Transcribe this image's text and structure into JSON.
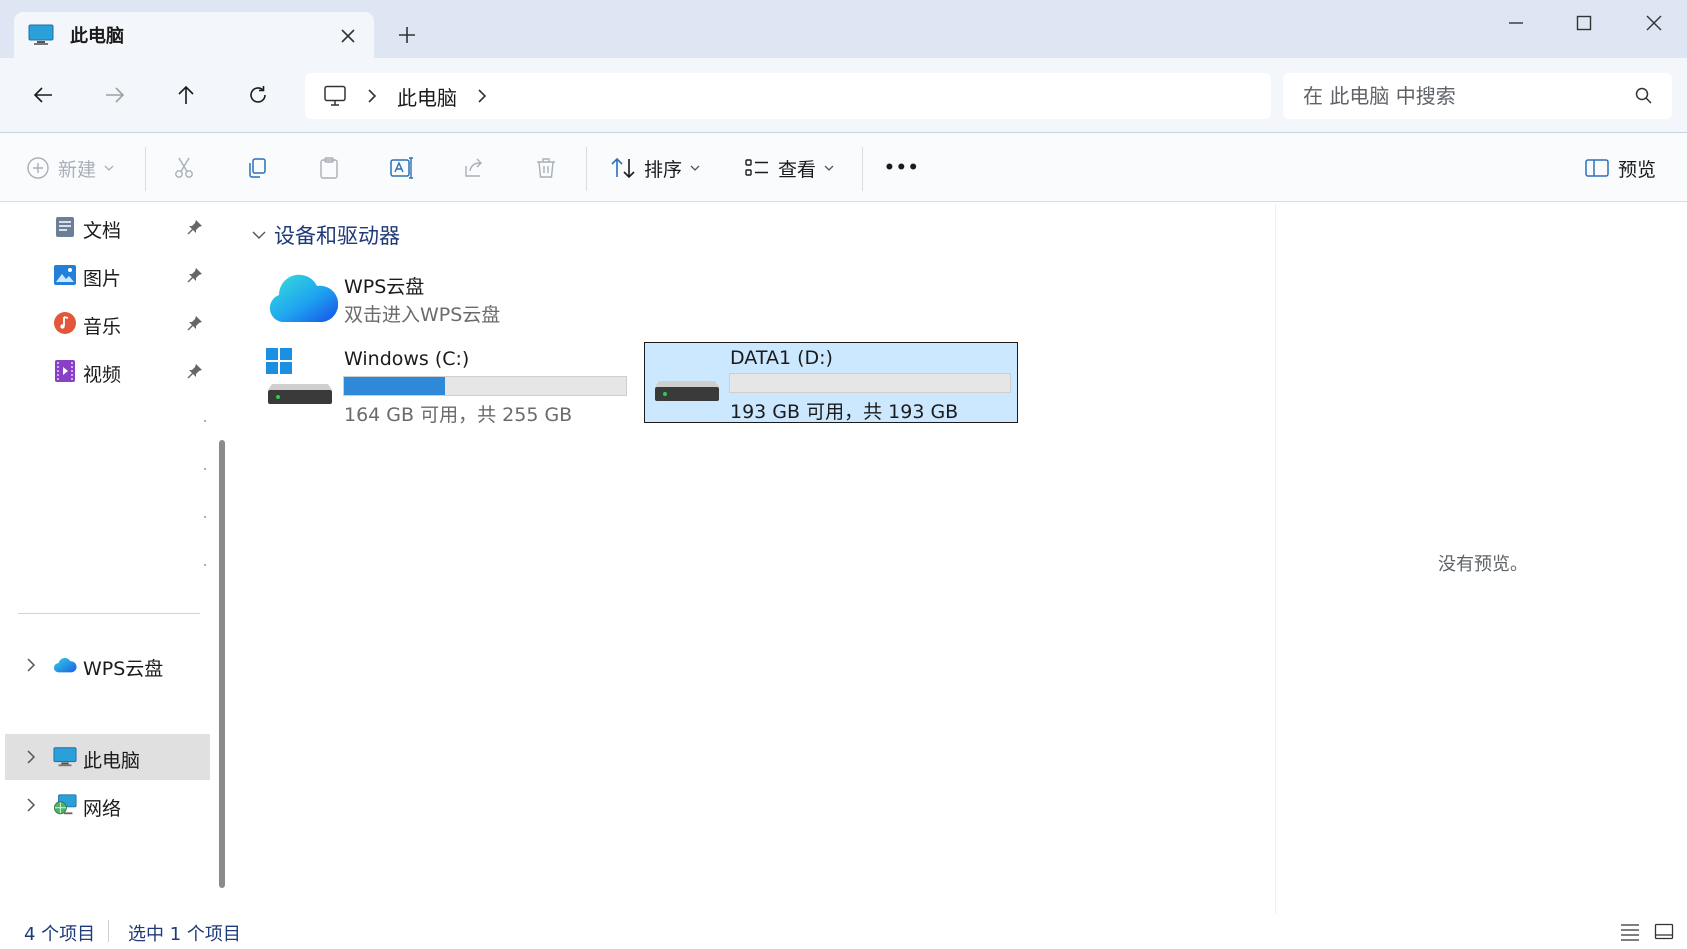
{
  "window": {
    "tab_title": "此电脑",
    "new_tab_glyph": "+"
  },
  "navigation": {
    "breadcrumb": [
      "此电脑"
    ],
    "search_placeholder": "在 此电脑 中搜索"
  },
  "toolbar": {
    "new_label": "新建",
    "sort_label": "排序",
    "view_label": "查看",
    "more_label": "•••",
    "preview_label": "预览"
  },
  "sidebar": {
    "quick_access": [
      {
        "label": "文档",
        "icon": "documents-icon"
      },
      {
        "label": "图片",
        "icon": "pictures-icon"
      },
      {
        "label": "音乐",
        "icon": "music-icon"
      },
      {
        "label": "视频",
        "icon": "videos-icon"
      }
    ],
    "locations": [
      {
        "label": "WPS云盘",
        "icon": "cloud-icon"
      },
      {
        "label": "此电脑",
        "icon": "this-pc-icon",
        "selected": true
      },
      {
        "label": "网络",
        "icon": "network-icon"
      }
    ]
  },
  "content": {
    "group_title": "设备和驱动器",
    "items": [
      {
        "title": "WPS云盘",
        "subtitle": "双击进入WPS云盘",
        "icon": "wps-cloud-icon"
      },
      {
        "title": "Windows (C:)",
        "subtitle": "164 GB 可用，共 255 GB",
        "icon": "windows-drive-icon",
        "used_fraction": 0.357
      },
      {
        "title": "DATA1 (D:)",
        "subtitle": "193 GB 可用，共 193 GB",
        "icon": "drive-icon",
        "used_fraction": 0.0,
        "selected": true
      }
    ]
  },
  "preview": {
    "empty_text": "没有预览。"
  },
  "status": {
    "item_count": "4 个项目",
    "selection": "选中 1 个项目"
  },
  "colors": {
    "accent": "#2e8ad8",
    "selection_bg": "#cce8ff",
    "titlebar_bg": "#dde6f2",
    "link_text": "#1e3a78"
  }
}
